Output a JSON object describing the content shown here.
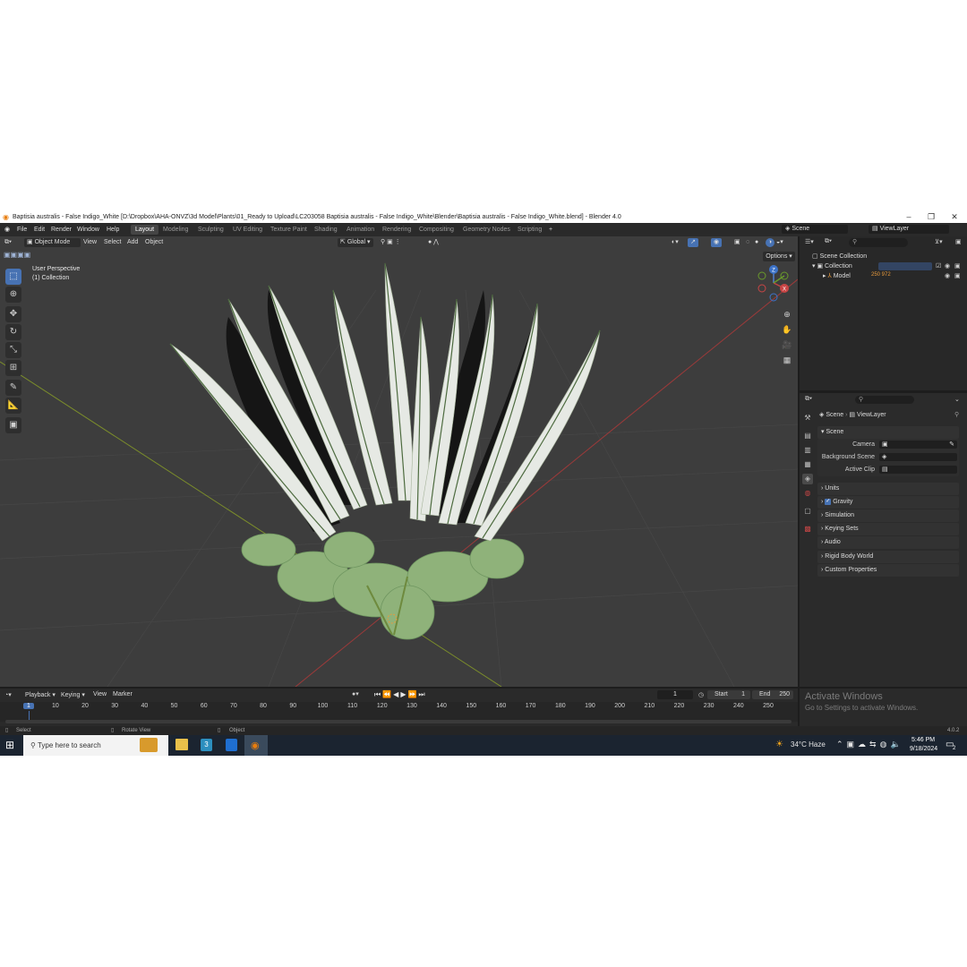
{
  "window": {
    "title": "Baptisia australis - False Indigo_White [D:\\Dropbox\\AHA-ONVZ\\3d Model\\Plants\\01_Ready to Upload\\LC203058 Baptisia australis - False Indigo_White\\Blender\\Baptisia australis - False Indigo_White.blend] - Blender 4.0"
  },
  "menubar": {
    "items": [
      "File",
      "Edit",
      "Render",
      "Window",
      "Help"
    ]
  },
  "workspaces": {
    "active": "Layout",
    "tabs": [
      "Layout",
      "Modeling",
      "Sculpting",
      "UV Editing",
      "Texture Paint",
      "Shading",
      "Animation",
      "Rendering",
      "Compositing",
      "Geometry Nodes",
      "Scripting"
    ],
    "add": "+"
  },
  "topright": {
    "scene": "Scene",
    "viewlayer": "ViewLayer"
  },
  "viewport": {
    "mode": "Object Mode",
    "menus": [
      "View",
      "Select",
      "Add",
      "Object"
    ],
    "transform": "Global",
    "options": "Options",
    "overlay_title": "User Perspective",
    "overlay_collection": "(1) Collection",
    "gizmo": {
      "x": "X",
      "y": "Y",
      "z": "Z"
    }
  },
  "outliner": {
    "root": "Scene Collection",
    "collection": "Collection",
    "model": "Model",
    "model_badge": "250 972"
  },
  "properties": {
    "breadcrumb_scene": "Scene",
    "breadcrumb_viewlayer": "ViewLayer",
    "section": "Scene",
    "camera_label": "Camera",
    "background_label": "Background Scene",
    "clip_label": "Active Clip",
    "panels": [
      "Units",
      "Gravity",
      "Simulation",
      "Keying Sets",
      "Audio",
      "Rigid Body World",
      "Custom Properties"
    ],
    "gravity_checked": true
  },
  "timeline": {
    "menus": [
      "Playback",
      "Keying",
      "View",
      "Marker"
    ],
    "current_frame": "1",
    "start_label": "Start",
    "start_value": "1",
    "end_label": "End",
    "end_value": "250",
    "ruler": [
      "1",
      "10",
      "20",
      "30",
      "40",
      "50",
      "60",
      "70",
      "80",
      "90",
      "100",
      "110",
      "120",
      "130",
      "140",
      "150",
      "160",
      "170",
      "180",
      "190",
      "200",
      "210",
      "220",
      "230",
      "240",
      "250"
    ]
  },
  "activate": {
    "title": "Activate Windows",
    "subtitle": "Go to Settings to activate Windows."
  },
  "statusbar": {
    "select": "Select",
    "rotate": "Rotate View",
    "object": "Object",
    "version": "4.0.2"
  },
  "taskbar": {
    "search_placeholder": "Type here to search",
    "weather": "34°C  Haze",
    "time": "5:46 PM",
    "date": "9/18/2024",
    "notif_count": "2"
  },
  "colors": {
    "accent": "#4772b3",
    "viewport_bg": "#3d3d3d",
    "ui_bg": "#2a2a2a",
    "selection_orange": "#e89a3c"
  }
}
